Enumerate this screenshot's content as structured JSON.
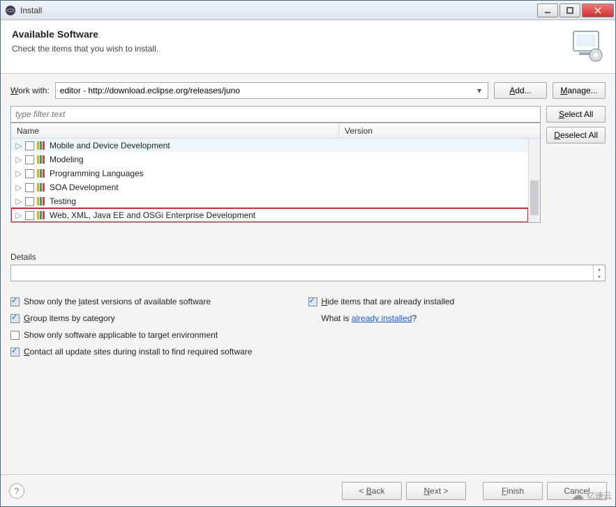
{
  "title": "Install",
  "header": {
    "title": "Available Software",
    "subtitle": "Check the items that you wish to install."
  },
  "workWith": {
    "label": "Work with:",
    "value": "editor - http://download.eclipse.org/releases/juno"
  },
  "buttons": {
    "add": "Add...",
    "manage": "Manage...",
    "selectAll": "Select All",
    "deselectAll": "Deselect All",
    "back": "< Back",
    "next": "Next >",
    "finish": "Finish",
    "cancel": "Cancel"
  },
  "filterPlaceholder": "type filter text",
  "columns": {
    "name": "Name",
    "version": "Version"
  },
  "tree": [
    {
      "label": "Mobile and Device Development",
      "hover": true
    },
    {
      "label": "Modeling"
    },
    {
      "label": "Programming Languages"
    },
    {
      "label": "SOA Development"
    },
    {
      "label": "Testing"
    },
    {
      "label": "Web, XML, Java EE and OSGi Enterprise Development",
      "highlight": true
    }
  ],
  "detailsLabel": "Details",
  "options": {
    "latest": "Show only the latest versions of available software",
    "group": "Group items by category",
    "applicable": "Show only software applicable to target environment",
    "contact": "Contact all update sites during install to find required software",
    "hide": "Hide items that are already installed",
    "whatIsPrefix": "What is ",
    "whatIsLink": "already installed",
    "whatIsSuffix": "?"
  },
  "watermark": "亿速云"
}
